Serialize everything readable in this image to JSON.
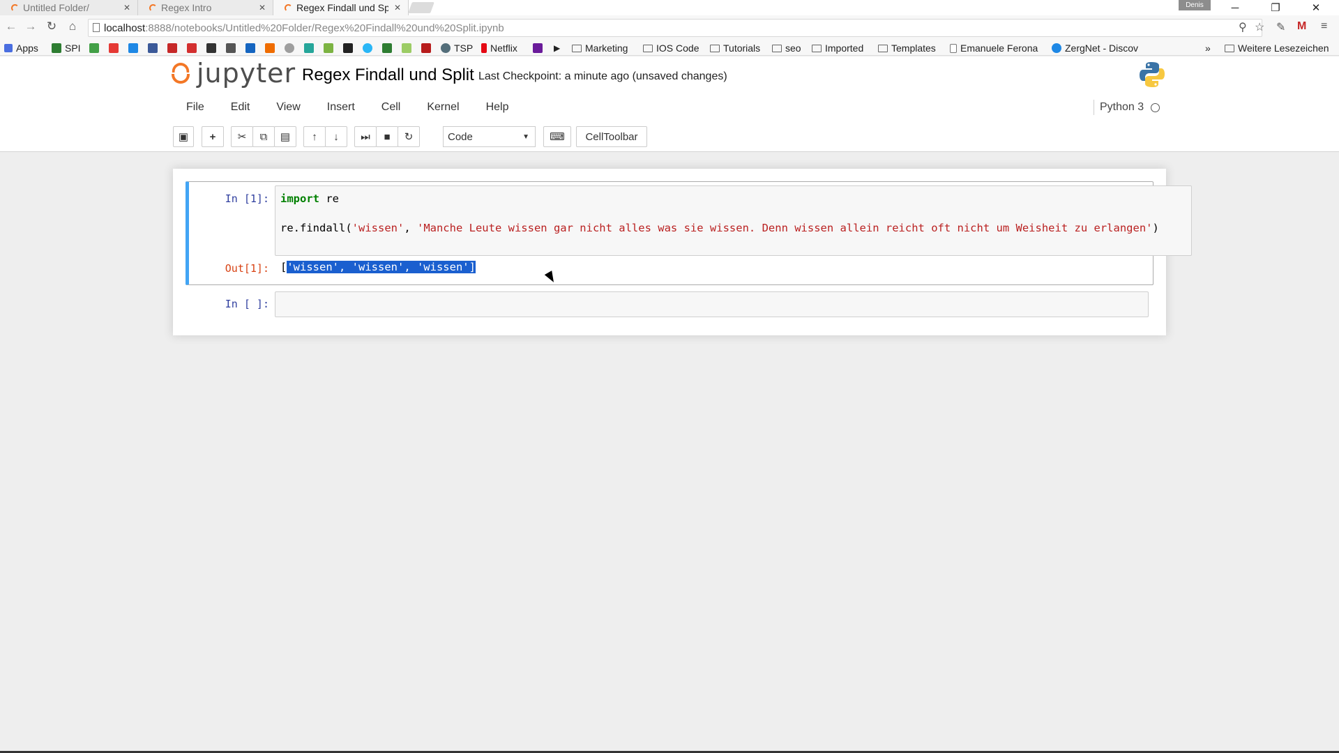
{
  "browser": {
    "tabs": [
      {
        "label": "Untitled Folder/",
        "active": false
      },
      {
        "label": "Regex Intro",
        "active": false
      },
      {
        "label": "Regex Findall und Sp",
        "active": true
      }
    ],
    "user_badge": "Denis",
    "url_host": "localhost",
    "url_path": ":8888/notebooks/Untitled%20Folder/Regex%20Findall%20und%20Split.ipynb",
    "bookmarks": {
      "apps": "Apps",
      "spi": "SPI",
      "tsp": "TSP",
      "netflix": "Netflix",
      "marketing": "Marketing",
      "ios_code": "IOS Code",
      "tutorials": "Tutorials",
      "seo": "seo",
      "imported": "Imported",
      "templates": "Templates",
      "emanuele": "Emanuele Ferona",
      "zergnet": "ZergNet - Discov",
      "more": "»",
      "weitere": "Weitere Lesezeichen"
    }
  },
  "jupyter": {
    "logo_text": "jupyter",
    "notebook_title": "Regex Findall und Split",
    "checkpoint": "Last Checkpoint: a minute ago (unsaved changes)",
    "menu": [
      "File",
      "Edit",
      "View",
      "Insert",
      "Cell",
      "Kernel",
      "Help"
    ],
    "kernel_name": "Python 3",
    "cell_type": "Code",
    "celltoolbar_label": "CellToolbar"
  },
  "cells": {
    "cell1_in_prompt": "In [1]:",
    "cell1_line1_kw": "import",
    "cell1_line1_rest": " re",
    "cell1_line2_fn": "re.findall(",
    "cell1_line2_arg1": "'wissen'",
    "cell1_line2_sep": ", ",
    "cell1_line2_arg2": "'Manche Leute wissen gar nicht alles was sie wissen. Denn wissen allein reicht oft nicht um Weisheit zu erlangen'",
    "cell1_line2_end": ")",
    "cell1_out_prompt": "Out[1]:",
    "cell1_output_open": "[",
    "cell1_output_selected": "'wissen', 'wissen', 'wissen']",
    "cell2_in_prompt": "In [ ]:"
  }
}
